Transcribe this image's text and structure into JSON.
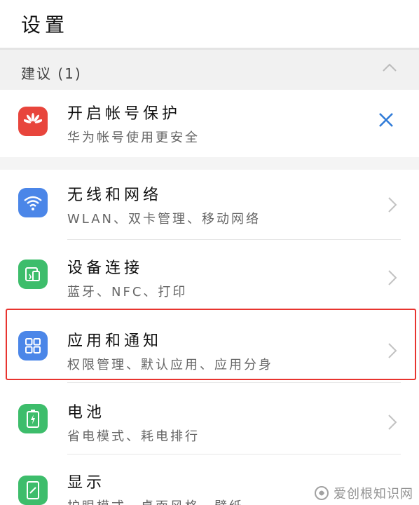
{
  "header": {
    "title": "设置"
  },
  "suggestions": {
    "label": "建议 (1)",
    "card": {
      "title": "开启帐号保护",
      "subtitle": "华为帐号使用更安全",
      "icon": "huawei-logo-icon",
      "icon_color": "#e8453c"
    }
  },
  "list": {
    "items": [
      {
        "title": "无线和网络",
        "subtitle": "WLAN、双卡管理、移动网络",
        "icon": "wifi-icon",
        "icon_color": "#4b86e8"
      },
      {
        "title": "设备连接",
        "subtitle": "蓝牙、NFC、打印",
        "icon": "device-connect-icon",
        "icon_color": "#3dbd6b"
      },
      {
        "title": "应用和通知",
        "subtitle": "权限管理、默认应用、应用分身",
        "icon": "apps-grid-icon",
        "icon_color": "#4b86e8"
      },
      {
        "title": "电池",
        "subtitle": "省电模式、耗电排行",
        "icon": "battery-icon",
        "icon_color": "#3dbd6b"
      },
      {
        "title": "显示",
        "subtitle": "护眼模式、桌面风格、壁纸",
        "icon": "display-icon",
        "icon_color": "#3dbd6b"
      }
    ]
  },
  "watermark": {
    "text": "爱创根知识网"
  },
  "colors": {
    "accent_blue": "#2f7bd8",
    "highlight_red": "#e8342f"
  }
}
